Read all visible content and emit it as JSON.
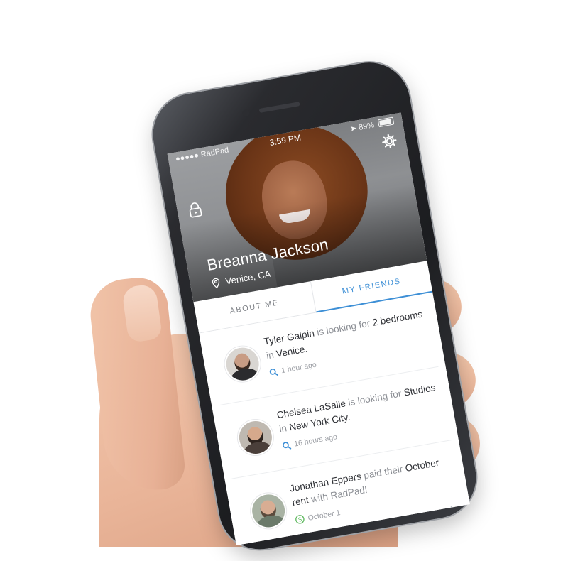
{
  "status_bar": {
    "carrier": "●●●●● RadPad",
    "time": "3:59 PM",
    "battery": "89%"
  },
  "profile": {
    "name": "Breanna Jackson",
    "location": "Venice, CA"
  },
  "tabs": [
    {
      "label": "ABOUT ME",
      "active": false
    },
    {
      "label": "MY FRIENDS",
      "active": true
    }
  ],
  "feed": [
    {
      "name": "Tyler Galpin",
      "verb": " is looking for ",
      "object": "2 bedrooms",
      "prep": " in ",
      "place": "Venice.",
      "time": "1 hour ago",
      "icon": "search-icon"
    },
    {
      "name": "Chelsea LaSalle",
      "verb": " is looking for ",
      "object": "Studios",
      "prep": " in ",
      "place": "New York City.",
      "time": "16 hours ago",
      "icon": "search-icon"
    },
    {
      "name": "Jonathan Eppers",
      "verb": " paid their ",
      "object": "October rent",
      "prep": " with RadPad!",
      "place": "",
      "time": "October 1",
      "icon": "dollar-icon"
    }
  ],
  "colors": {
    "accent": "#3d8fd6",
    "dollar": "#5cb85c",
    "text_dark": "#2f3136",
    "text_muted": "#8b8e94"
  }
}
